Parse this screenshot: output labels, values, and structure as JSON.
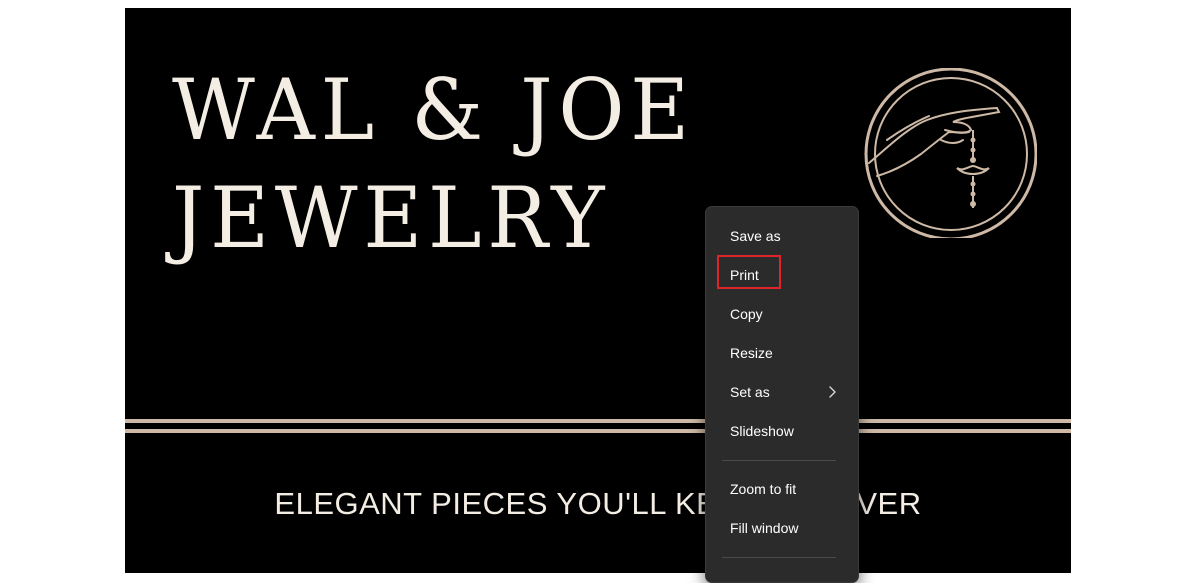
{
  "banner": {
    "title_line_1": "WAL & JOE",
    "title_line_2": "JEWELRY",
    "tagline": "ELEGANT PIECES YOU'LL KEEP FOREVER",
    "logo_icon": "hand-holding-necklace-icon",
    "background_color": "#000000",
    "text_color": "#f3ede4",
    "accent_color": "#cdb9a5"
  },
  "context_menu": {
    "items": [
      {
        "label": "Save as"
      },
      {
        "label": "Print"
      },
      {
        "label": "Copy"
      },
      {
        "label": "Resize"
      },
      {
        "label": "Set as",
        "has_submenu": true
      },
      {
        "label": "Slideshow"
      },
      {
        "label": "Zoom to fit"
      },
      {
        "label": "Fill window"
      }
    ],
    "submenu_icon": "chevron-right-icon",
    "background_color": "#2b2b2b"
  },
  "annotation": {
    "highlighted_item": "Print",
    "color": "#e0242b"
  }
}
